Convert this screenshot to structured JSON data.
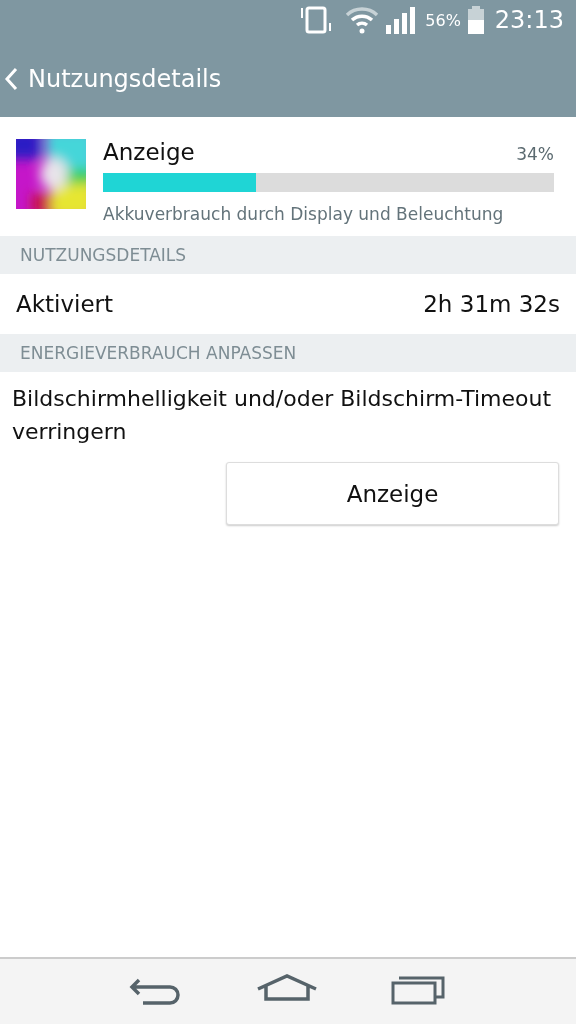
{
  "status_bar": {
    "battery_percent": "56%",
    "time": "23:13"
  },
  "app_bar": {
    "title": "Nutzungsdetails"
  },
  "usage_item": {
    "name": "Anzeige",
    "percent": "34%",
    "level": 0.34,
    "description": "Akkuverbrauch durch Display und Beleuchtung"
  },
  "sections": [
    {
      "header": "NUTZUNGSDETAILS",
      "kind": "row",
      "label": "Aktiviert",
      "value": "2h 31m 32s"
    },
    {
      "header": "ENERGIEVERBRAUCH ANPASSEN",
      "kind": "hint",
      "text": "Bildschirmhelligkeit und/oder Bildschirm-Timeout verringern",
      "button": "Anzeige"
    }
  ]
}
